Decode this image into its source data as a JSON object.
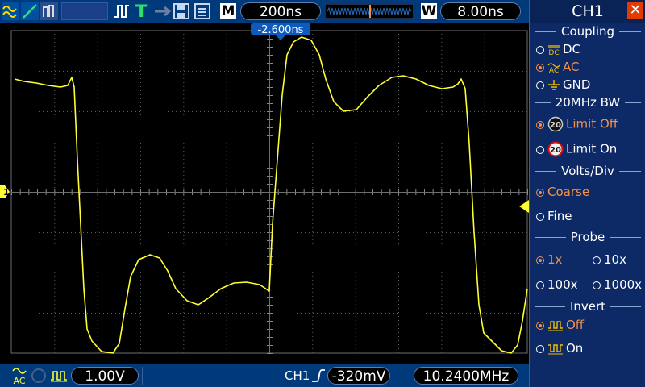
{
  "topbar": {
    "timebase": "200ns",
    "trigger_offset": "-2.600ns",
    "window_label": "8.00ns",
    "m_label": "M",
    "w_label": "W",
    "trigger_mode_letter": "T"
  },
  "bottombar": {
    "volts_per_div": "1.00V",
    "trigger_channel": "CH1",
    "trigger_level": "-320mV",
    "frequency": "10.2400MHz"
  },
  "scope": {
    "channel_marker": "1"
  },
  "panel": {
    "title": "CH1",
    "coupling": {
      "heading": "Coupling",
      "options": [
        "DC",
        "AC",
        "GND"
      ],
      "selected": "AC"
    },
    "bw": {
      "heading": "20MHz BW",
      "options": [
        "Limit Off",
        "Limit On"
      ],
      "selected": "Limit Off"
    },
    "volts": {
      "heading": "Volts/Div",
      "options": [
        "Coarse",
        "Fine"
      ],
      "selected": "Coarse"
    },
    "probe": {
      "heading": "Probe",
      "options": [
        "1x",
        "10x",
        "100x",
        "1000x"
      ],
      "selected": "1x"
    },
    "invert": {
      "heading": "Invert",
      "options": [
        "Off",
        "On"
      ],
      "selected": "Off"
    }
  },
  "colors": {
    "trace": "#ffff33",
    "accent": "#f2914a",
    "bar_bg": "#003a7a"
  }
}
